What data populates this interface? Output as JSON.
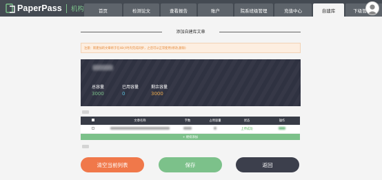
{
  "header": {
    "logo_text": "PaperPass",
    "logo_sub": "机构版",
    "tabs": [
      {
        "label": "首页",
        "active": false
      },
      {
        "label": "检测论文",
        "active": false
      },
      {
        "label": "查看报告",
        "active": false
      },
      {
        "label": "账户",
        "active": false
      },
      {
        "label": "院系班级管理",
        "active": false
      },
      {
        "label": "充值中心",
        "active": false
      },
      {
        "label": "自建库",
        "active": true
      },
      {
        "label": "下级管理员",
        "active": false
      }
    ]
  },
  "page": {
    "title": "添加自建库文章",
    "notice": "注意：新建加的文章将于在48小时内完成同步，之后可以正常使用(修改,删除)"
  },
  "library": {
    "stats": [
      {
        "label": "总容量",
        "value": "3000",
        "color": "#7cc18a"
      },
      {
        "label": "已用容量",
        "value": "0",
        "color": "#5bc0de"
      },
      {
        "label": "剩余容量",
        "value": "3000",
        "color": "#f0ad4e"
      }
    ]
  },
  "table": {
    "columns": [
      "",
      "文章名称",
      "字数",
      "占用容量",
      "状态",
      "操作"
    ],
    "rows": [
      {
        "status": "上传成功"
      }
    ],
    "add_label": "+ 继续添加"
  },
  "actions": {
    "clear_label": "清空当前列表",
    "save_label": "保存",
    "back_label": "返回",
    "clear_color": "#f0784a",
    "save_color": "#7cc18a",
    "back_color": "#3c3f4c"
  }
}
